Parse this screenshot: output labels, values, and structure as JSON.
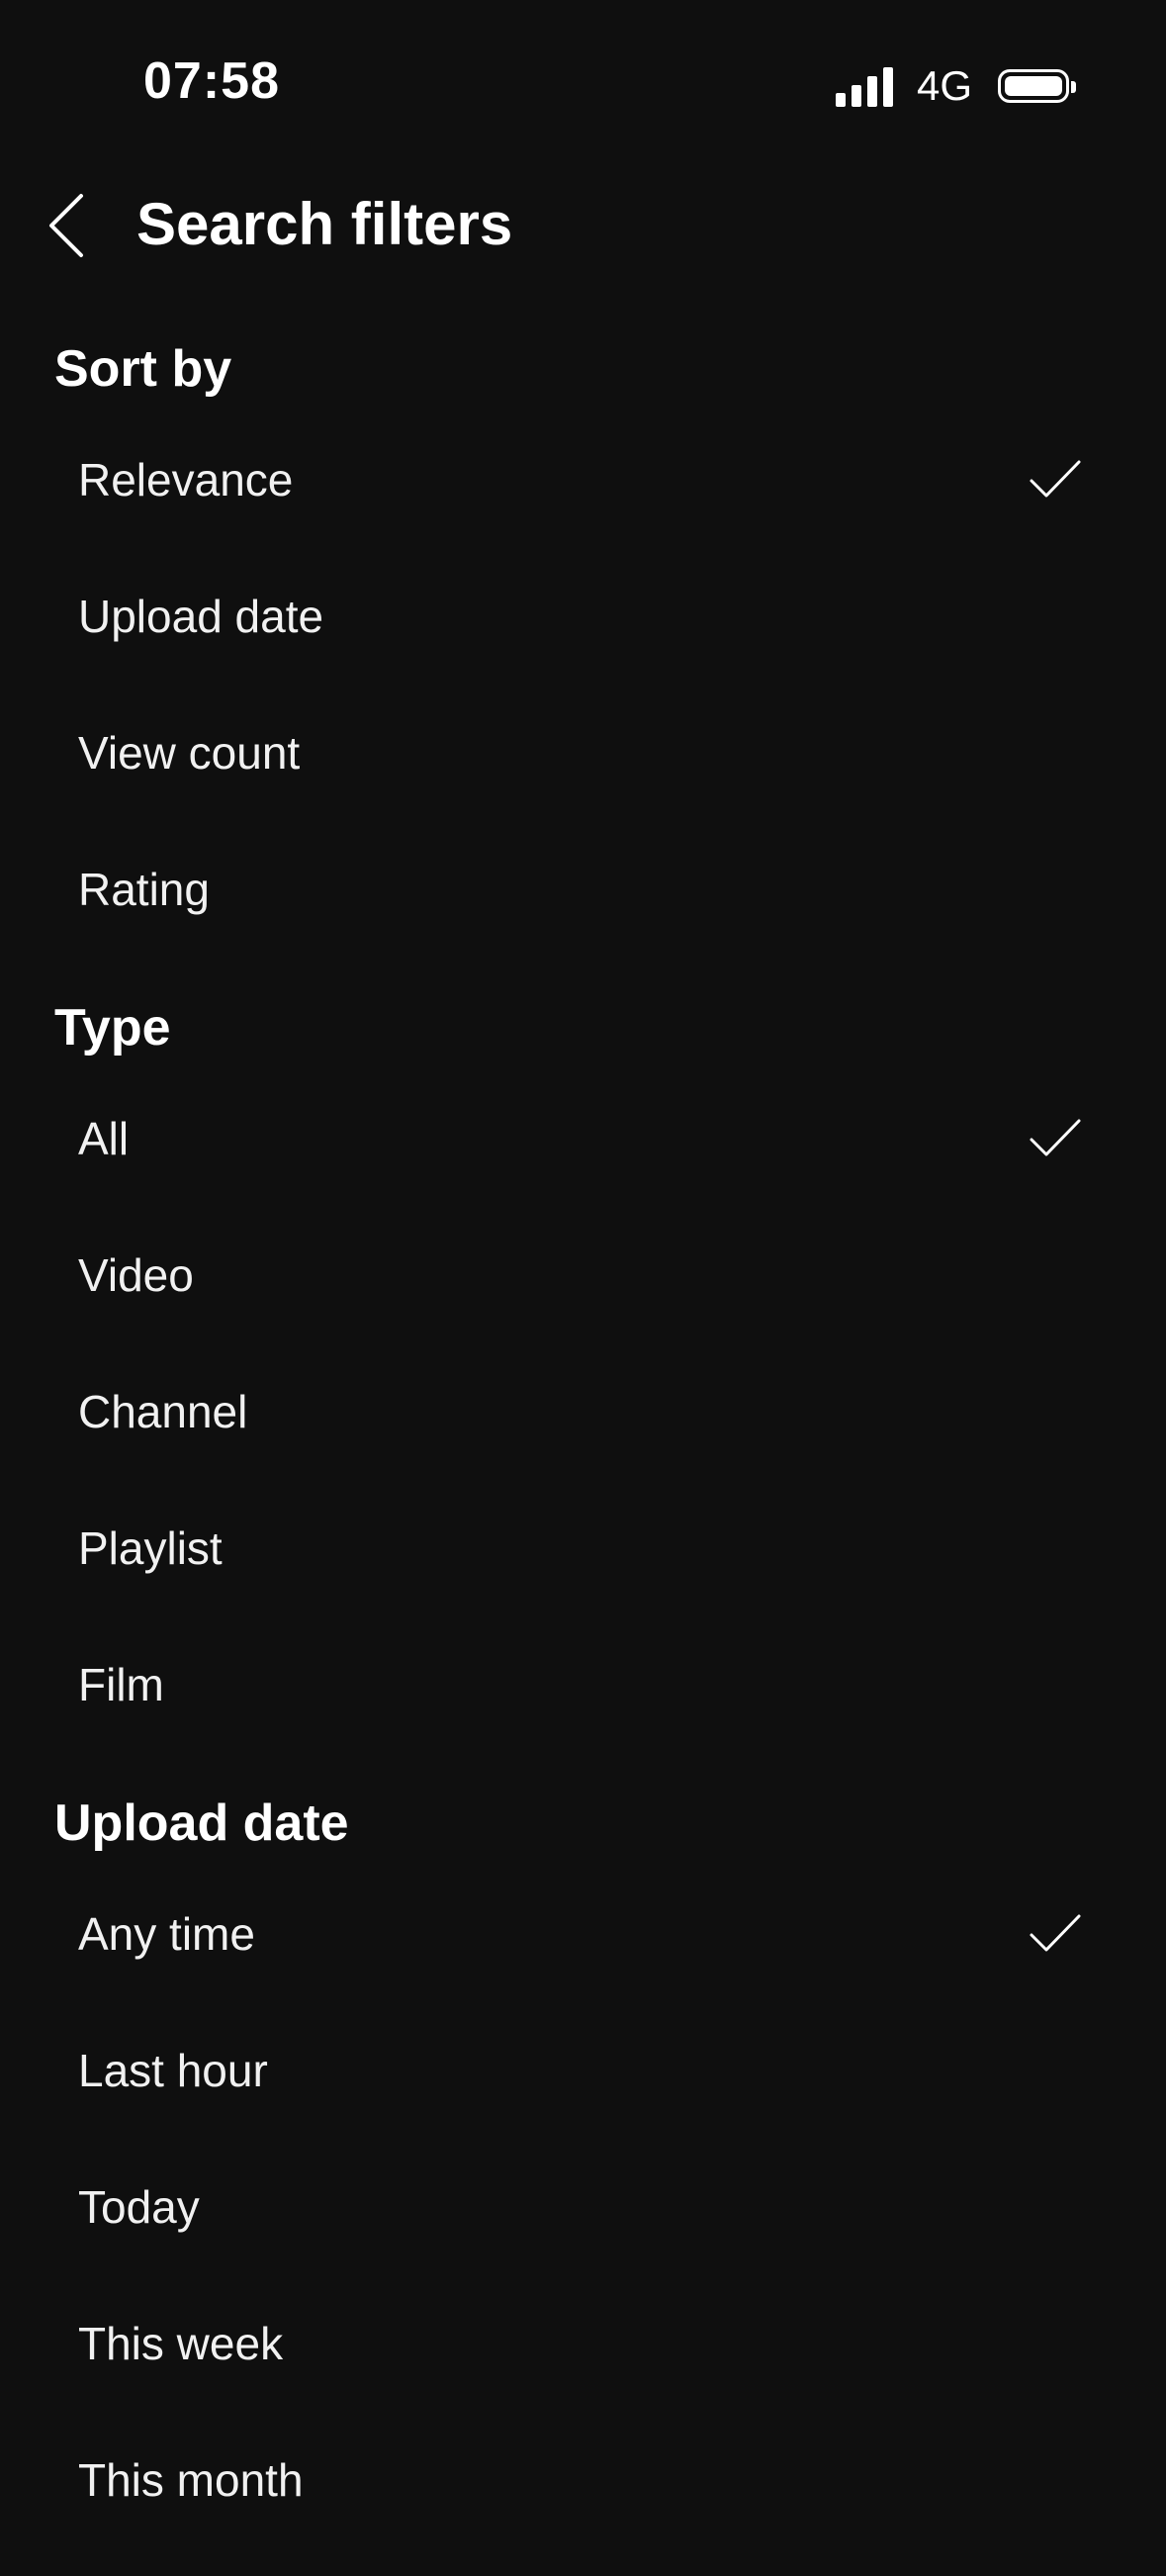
{
  "status_bar": {
    "time": "07:58",
    "network": "4G"
  },
  "header": {
    "title": "Search filters"
  },
  "sections": [
    {
      "title": "Sort by",
      "options": [
        {
          "label": "Relevance",
          "selected": true
        },
        {
          "label": "Upload date",
          "selected": false
        },
        {
          "label": "View count",
          "selected": false
        },
        {
          "label": "Rating",
          "selected": false
        }
      ]
    },
    {
      "title": "Type",
      "options": [
        {
          "label": "All",
          "selected": true
        },
        {
          "label": "Video",
          "selected": false
        },
        {
          "label": "Channel",
          "selected": false
        },
        {
          "label": "Playlist",
          "selected": false
        },
        {
          "label": "Film",
          "selected": false
        }
      ]
    },
    {
      "title": "Upload date",
      "options": [
        {
          "label": "Any time",
          "selected": true
        },
        {
          "label": "Last hour",
          "selected": false
        },
        {
          "label": "Today",
          "selected": false
        },
        {
          "label": "This week",
          "selected": false
        },
        {
          "label": "This month",
          "selected": false
        }
      ]
    }
  ],
  "colors": {
    "background": "#0f0f0f",
    "text": "#f1f1f1"
  },
  "icons": {
    "back": "chevron-left-icon",
    "selected": "checkmark-icon"
  }
}
